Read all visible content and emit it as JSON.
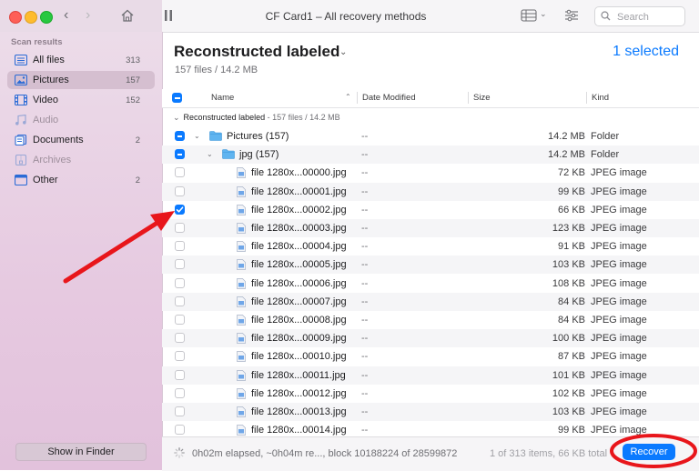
{
  "window": {
    "title": "CF Card1 – All recovery methods"
  },
  "search": {
    "placeholder": "Search"
  },
  "sidebar": {
    "heading": "Scan results",
    "items": [
      {
        "label": "All files",
        "count": "313",
        "icon": "all-files-icon",
        "selected": false
      },
      {
        "label": "Pictures",
        "count": "157",
        "icon": "pictures-icon",
        "selected": true
      },
      {
        "label": "Video",
        "count": "152",
        "icon": "video-icon",
        "selected": false
      },
      {
        "label": "Audio",
        "count": "",
        "icon": "audio-icon",
        "selected": false,
        "dimmed": true
      },
      {
        "label": "Documents",
        "count": "2",
        "icon": "documents-icon",
        "selected": false
      },
      {
        "label": "Archives",
        "count": "",
        "icon": "archives-icon",
        "selected": false,
        "dimmed": true
      },
      {
        "label": "Other",
        "count": "2",
        "icon": "other-icon",
        "selected": false
      }
    ],
    "show_in_finder": "Show in Finder"
  },
  "main": {
    "title": "Reconstructed labeled",
    "subtitle": "157 files / 14.2 MB",
    "selected_count": "1 selected"
  },
  "columns": {
    "name": "Name",
    "date": "Date Modified",
    "size": "Size",
    "kind": "Kind"
  },
  "group": {
    "label": "Reconstructed labeled",
    "meta": " - 157 files / 14.2 MB"
  },
  "rows": [
    {
      "name": "Pictures (157)",
      "date": "--",
      "size": "14.2 MB",
      "kind": "Folder",
      "level": 0,
      "type": "folder",
      "check": "mixed"
    },
    {
      "name": "jpg (157)",
      "date": "--",
      "size": "14.2 MB",
      "kind": "Folder",
      "level": 1,
      "type": "folder",
      "check": "mixed"
    },
    {
      "name": "file 1280x...00000.jpg",
      "date": "--",
      "size": "72 KB",
      "kind": "JPEG image",
      "level": 2,
      "type": "file",
      "check": "none"
    },
    {
      "name": "file 1280x...00001.jpg",
      "date": "--",
      "size": "99 KB",
      "kind": "JPEG image",
      "level": 2,
      "type": "file",
      "check": "none"
    },
    {
      "name": "file 1280x...00002.jpg",
      "date": "--",
      "size": "66 KB",
      "kind": "JPEG image",
      "level": 2,
      "type": "file",
      "check": "checked"
    },
    {
      "name": "file 1280x...00003.jpg",
      "date": "--",
      "size": "123 KB",
      "kind": "JPEG image",
      "level": 2,
      "type": "file",
      "check": "none"
    },
    {
      "name": "file 1280x...00004.jpg",
      "date": "--",
      "size": "91 KB",
      "kind": "JPEG image",
      "level": 2,
      "type": "file",
      "check": "none"
    },
    {
      "name": "file 1280x...00005.jpg",
      "date": "--",
      "size": "103 KB",
      "kind": "JPEG image",
      "level": 2,
      "type": "file",
      "check": "none"
    },
    {
      "name": "file 1280x...00006.jpg",
      "date": "--",
      "size": "108 KB",
      "kind": "JPEG image",
      "level": 2,
      "type": "file",
      "check": "none"
    },
    {
      "name": "file 1280x...00007.jpg",
      "date": "--",
      "size": "84 KB",
      "kind": "JPEG image",
      "level": 2,
      "type": "file",
      "check": "none"
    },
    {
      "name": "file 1280x...00008.jpg",
      "date": "--",
      "size": "84 KB",
      "kind": "JPEG image",
      "level": 2,
      "type": "file",
      "check": "none"
    },
    {
      "name": "file 1280x...00009.jpg",
      "date": "--",
      "size": "100 KB",
      "kind": "JPEG image",
      "level": 2,
      "type": "file",
      "check": "none"
    },
    {
      "name": "file 1280x...00010.jpg",
      "date": "--",
      "size": "87 KB",
      "kind": "JPEG image",
      "level": 2,
      "type": "file",
      "check": "none"
    },
    {
      "name": "file 1280x...00011.jpg",
      "date": "--",
      "size": "101 KB",
      "kind": "JPEG image",
      "level": 2,
      "type": "file",
      "check": "none"
    },
    {
      "name": "file 1280x...00012.jpg",
      "date": "--",
      "size": "102 KB",
      "kind": "JPEG image",
      "level": 2,
      "type": "file",
      "check": "none"
    },
    {
      "name": "file 1280x...00013.jpg",
      "date": "--",
      "size": "103 KB",
      "kind": "JPEG image",
      "level": 2,
      "type": "file",
      "check": "none"
    },
    {
      "name": "file 1280x...00014.jpg",
      "date": "--",
      "size": "99 KB",
      "kind": "JPEG image",
      "level": 2,
      "type": "file",
      "check": "none"
    }
  ],
  "status": {
    "progress_text": "0h02m elapsed, ~0h04m re..., block 10188224 of 28599872",
    "summary": "1 of 313 items, 66 KB total",
    "recover_label": "Recover"
  },
  "colors": {
    "accent": "#0a7aff",
    "annotation": "#e8161b"
  }
}
